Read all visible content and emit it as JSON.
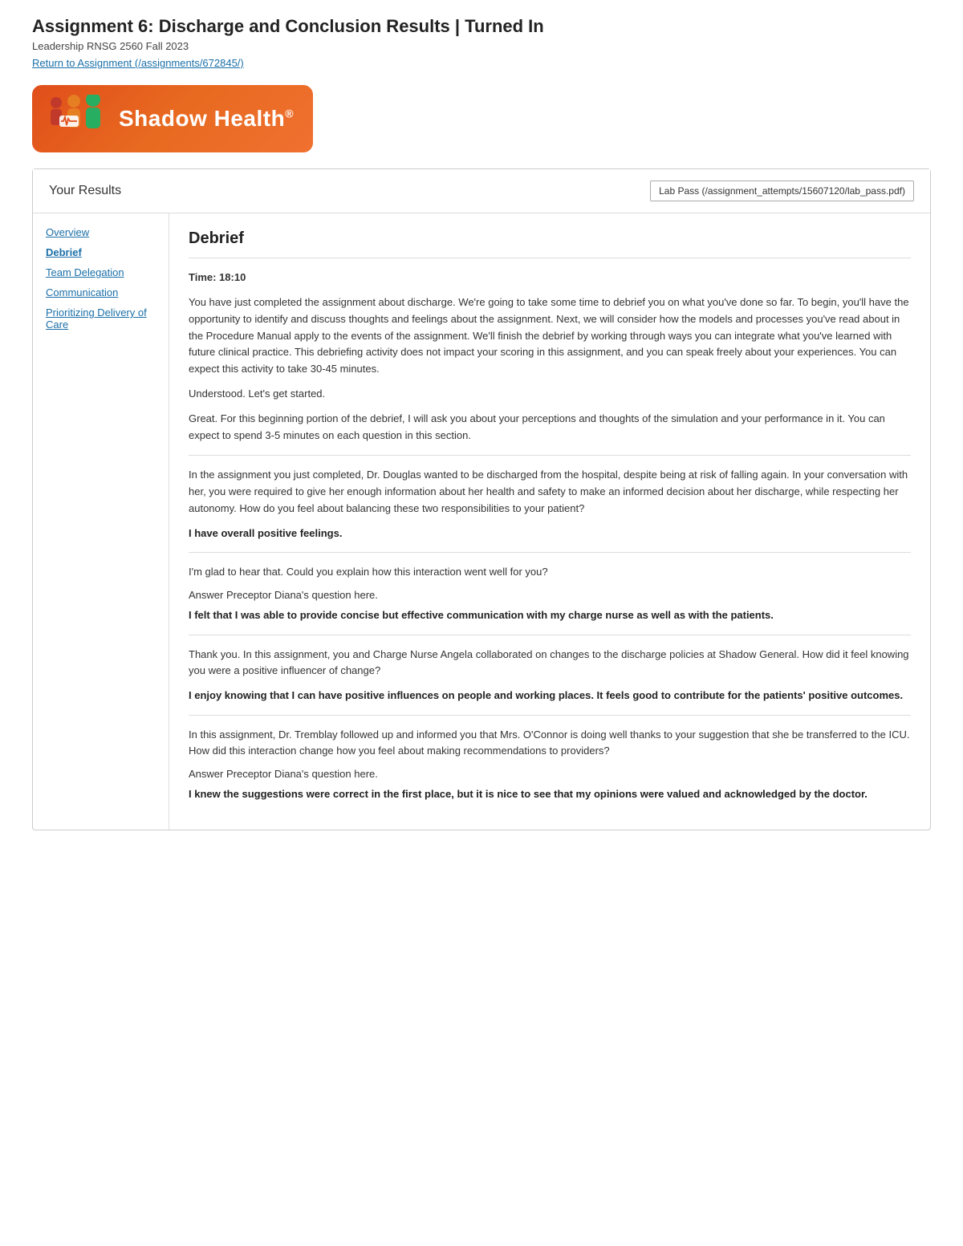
{
  "header": {
    "title": "Assignment 6: Discharge and Conclusion Results | Turned In",
    "subtitle": "Leadership RNSG 2560 Fall 2023",
    "return_link_text": "Return to Assignment (/assignments/672845/)",
    "return_link_href": "/assignments/672845/"
  },
  "logo": {
    "text": "Shadow Health",
    "registered_symbol": "®"
  },
  "results": {
    "title": "Your Results",
    "lab_pass_label": "Lab Pass (/assignment_attempts/15607120/lab_pass.pdf)"
  },
  "sidebar": {
    "items": [
      {
        "label": "Overview",
        "active": false
      },
      {
        "label": "Debrief",
        "active": true
      },
      {
        "label": "Team Delegation",
        "active": false
      },
      {
        "label": "Communication",
        "active": false
      },
      {
        "label": "Prioritizing Delivery of Care",
        "active": false
      }
    ]
  },
  "debrief": {
    "section_title": "Debrief",
    "time_label": "Time: 18:10",
    "blocks": [
      {
        "type": "text",
        "content": "You have just completed the assignment about discharge. We're going to take some time to debrief you on what you've done so far. To begin, you'll have the opportunity to identify and discuss thoughts and feelings about the assignment. Next, we will consider how the models and processes you've read about in the Procedure Manual apply to the events of the assignment. We'll finish the debrief by working through ways you can integrate what you've learned with future clinical practice. This debriefing activity does not impact your scoring in this assignment, and you can speak freely about your experiences. You can expect this activity to take 30-45 minutes."
      },
      {
        "type": "text",
        "content": "Understood. Let's get started."
      },
      {
        "type": "text",
        "content": "Great. For this beginning portion of the debrief, I will ask you about your perceptions and thoughts of the simulation and your performance in it. You can expect to spend 3-5 minutes on each question in this section."
      },
      {
        "type": "separator"
      },
      {
        "type": "text",
        "content": "In the assignment you just completed, Dr. Douglas wanted to be discharged from the hospital, despite being at risk of falling again. In your conversation with her, you were required to give her enough information about her health and safety to make an informed decision about her discharge, while respecting her autonomy. How do you feel about balancing these two responsibilities to your patient?"
      },
      {
        "type": "answer",
        "content": "I have overall positive feelings."
      },
      {
        "type": "separator"
      },
      {
        "type": "text",
        "content": "I'm glad to hear that. Could you explain how this interaction went well for you?"
      },
      {
        "type": "prompt",
        "content": "Answer Preceptor Diana's question here."
      },
      {
        "type": "answer",
        "content": "I felt that I was able to provide concise but effective communication with my charge nurse as well as with the patients."
      },
      {
        "type": "separator"
      },
      {
        "type": "text",
        "content": "Thank you. In this assignment, you and Charge Nurse Angela collaborated on changes to the discharge policies at Shadow General. How did it feel knowing you were a positive influencer of change?"
      },
      {
        "type": "answer",
        "content": "I enjoy knowing that I can have positive influences on people and working places. It feels good to contribute for the patients' positive outcomes."
      },
      {
        "type": "separator"
      },
      {
        "type": "text",
        "content": "In this assignment, Dr. Tremblay followed up and informed you that Mrs. O'Connor is doing well thanks to your suggestion that she be transferred to the ICU. How did this interaction change how you feel about making recommendations to providers?"
      },
      {
        "type": "prompt",
        "content": "Answer Preceptor Diana's question here."
      },
      {
        "type": "answer",
        "content": "I knew the suggestions were correct in the first place, but it is nice to see that my opinions were valued and acknowledged by the doctor."
      }
    ]
  }
}
